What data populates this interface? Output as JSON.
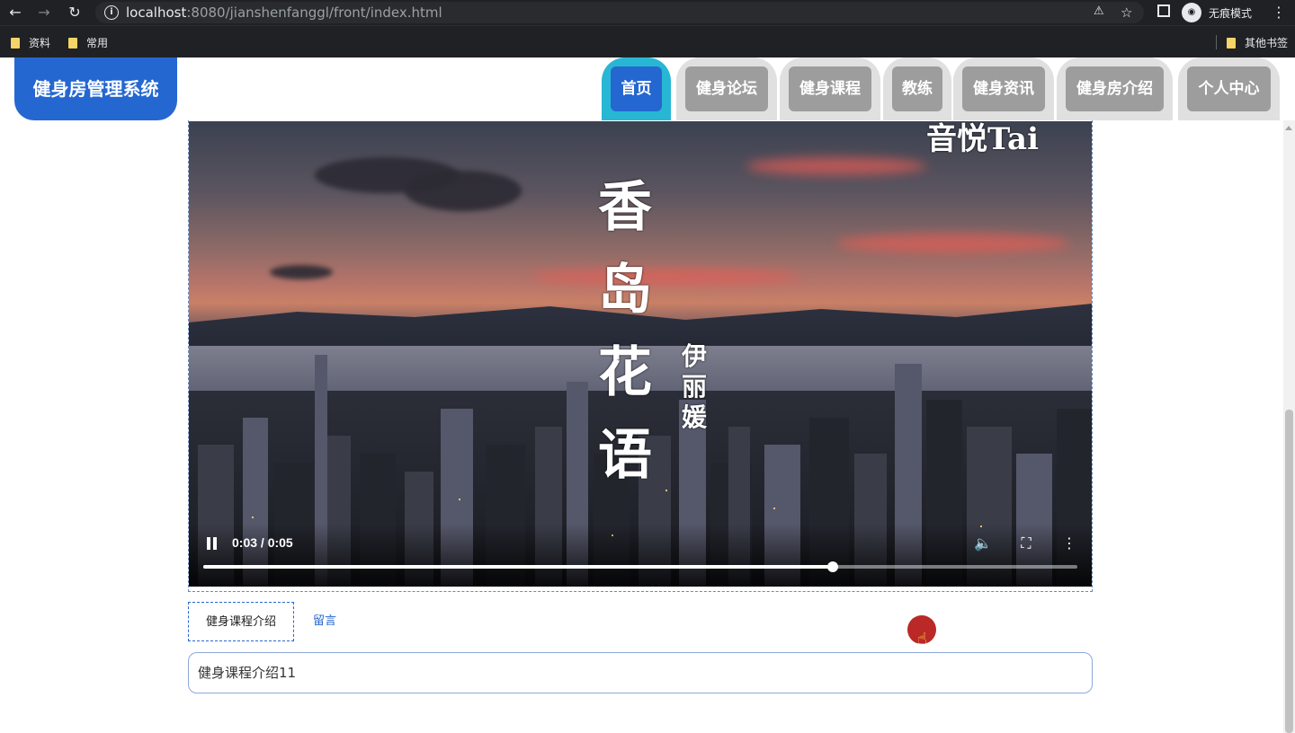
{
  "browser": {
    "url_host": "localhost",
    "url_rest": ":8080/jianshenfanggl/front/index.html",
    "profile_label": "无痕模式",
    "bookmarks": [
      "资料",
      "常用"
    ],
    "other_bookmarks": "其他书签"
  },
  "site": {
    "logo": "健身房管理系统",
    "nav": [
      "首页",
      "健身论坛",
      "健身课程",
      "教练",
      "健身资讯",
      "健身房介绍",
      "个人中心"
    ],
    "active_nav": "首页"
  },
  "video": {
    "time": "0:03 / 0:05",
    "progress": 0.72,
    "overlay_title": "香岛花语",
    "overlay_artist": "伊丽媛",
    "overlay_corner": "音悦Tai"
  },
  "tabs": {
    "intro": "健身课程介绍",
    "comments": "留言"
  },
  "content": {
    "text": "健身课程介绍11"
  }
}
